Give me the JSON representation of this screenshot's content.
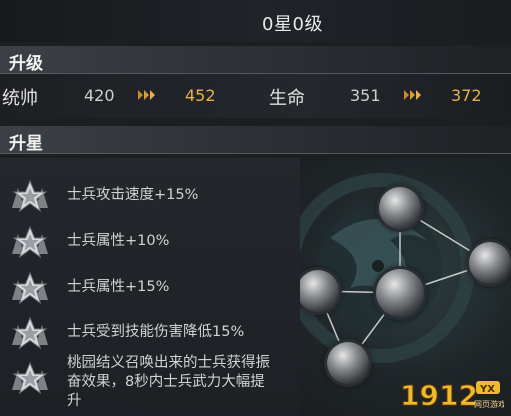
{
  "header": {
    "star_level": "0星0级"
  },
  "upgrade": {
    "title": "升级",
    "stats": [
      {
        "label": "统帅",
        "old": "420",
        "new": "452"
      },
      {
        "label": "生命",
        "old": "351",
        "new": "372"
      }
    ]
  },
  "star_up": {
    "title": "升星",
    "effects": [
      {
        "text": "士兵攻击速度+15%"
      },
      {
        "text": "士兵属性+10%"
      },
      {
        "text": "士兵属性+15%"
      },
      {
        "text": "士兵受到技能伤害降低15%"
      },
      {
        "line1": "桃园结义召唤出来的士兵获得振",
        "line2": "奋效果，8秒内士兵武力大幅提",
        "line3": "升"
      }
    ]
  },
  "watermark": {
    "brand": "1912",
    "tag": "YX",
    "sub": "网页游戏"
  },
  "colors": {
    "accent_gold": "#e7b24a",
    "text": "#d2d2d2",
    "section_bg": "#3c4047"
  },
  "icons": [
    "arrow-right-icon",
    "star-badge-icon",
    "star-orb-icon"
  ]
}
